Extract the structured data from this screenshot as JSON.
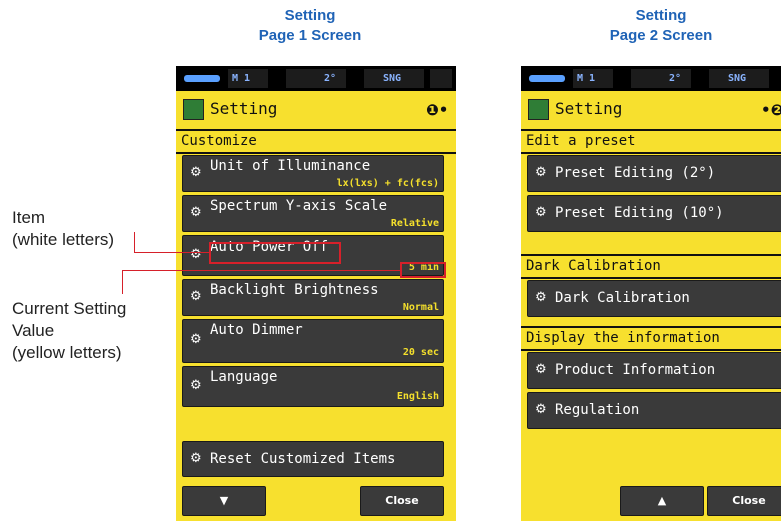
{
  "captions": {
    "left_line1": "Setting",
    "left_line2": "Page 1 Screen",
    "right_line1": "Setting",
    "right_line2": "Page 2 Screen"
  },
  "callouts": {
    "item_line1": "Item",
    "item_line2": "(white letters)",
    "value_line1": "Current Setting",
    "value_line2": "Value",
    "value_line3": "(yellow letters)"
  },
  "status_bar": {
    "channel": "M 1",
    "angle": "2°",
    "mode": "SNG"
  },
  "page1": {
    "title": "Setting",
    "page_indicator": "❶•",
    "section": "Customize",
    "items": [
      {
        "label": "Unit of Illuminance",
        "value": "lx(lxs) + fc(fcs)"
      },
      {
        "label": "Spectrum Y-axis Scale",
        "value": "Relative"
      },
      {
        "label": "Auto Power Off",
        "value": "5 min"
      },
      {
        "label": "Backlight Brightness",
        "value": "Normal"
      },
      {
        "label": "Auto Dimmer",
        "value": "20 sec"
      },
      {
        "label": "Language",
        "value": "English"
      }
    ],
    "reset_label": "Reset Customized Items",
    "down_label": "▼",
    "close_label": "Close"
  },
  "page2": {
    "title": "Setting",
    "page_indicator": "•❷",
    "sections": [
      "Edit a preset",
      "Dark Calibration",
      "Display the information"
    ],
    "items": [
      {
        "label": "Preset Editing (2°)"
      },
      {
        "label": "Preset Editing (10°)"
      },
      {
        "label": "Dark Calibration"
      },
      {
        "label": "Product Information"
      },
      {
        "label": "Regulation"
      }
    ],
    "up_label": "▲",
    "close_label": "Close"
  },
  "colors": {
    "screen_bg": "#f7e02e",
    "item_bg": "#3a3a3a",
    "value_text": "#f5e02c",
    "callout_red": "#d6202a",
    "caption_blue": "#1f63b6"
  },
  "icons": {
    "settings_item": "gear-icon",
    "title": "setting-app-icon"
  }
}
